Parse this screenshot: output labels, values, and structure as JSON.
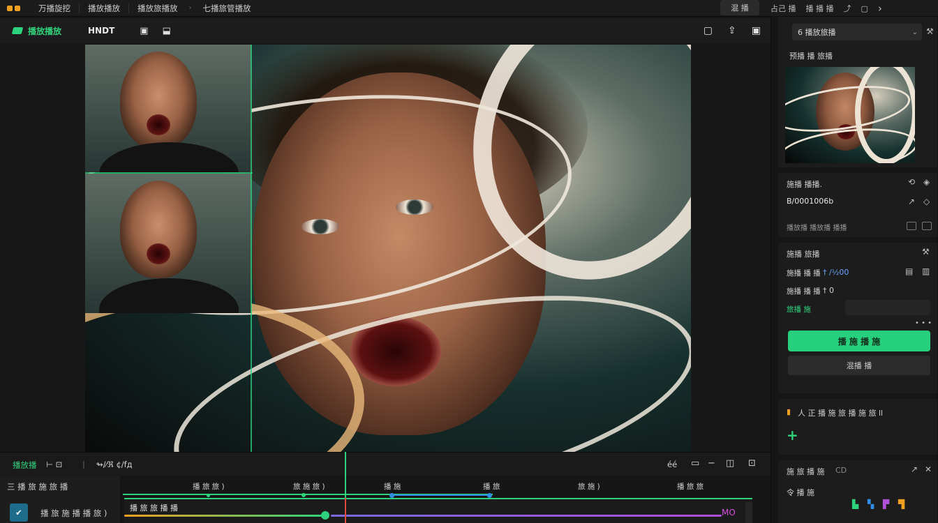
{
  "menubar": {
    "items": [
      "万播旋挖",
      "播放播放",
      "播放旅播放",
      "七播旅管播放"
    ],
    "right_button": "混  播",
    "right_items": [
      "占己 播",
      "播 播 播"
    ]
  },
  "toolbar": {
    "brand": "播放播放",
    "mode": "HNDT"
  },
  "right_panel": {
    "dropdown_value": "6 播放旅播",
    "preview_title": "预播 播 旅播",
    "section1": {
      "title": "施播 播播.",
      "value": "B/0001006b",
      "note": "播放播 播放播 播播"
    },
    "section2": {
      "title": "施播 旅播",
      "row1_label": "施播 播 播",
      "row1_value": "† /½00",
      "row2_label": "施播 播 播",
      "row2_value": "† 0",
      "row3_label": "旅播 施",
      "primary_button": "播 施 播 施",
      "secondary_button": "混播 播"
    },
    "section3": {
      "title": "人 正 播 施 旅 播 施 旅 ll",
      "add": "+"
    },
    "section4": {
      "title": "施 旅 播 施",
      "tab2": "CD",
      "subtitle": "令 播 施"
    }
  },
  "timeline": {
    "toolbar_left": "播放播",
    "toolbar_mid": "⊢ ⊡",
    "toolbar_text": "↬/⁄ℜ ¢/fд",
    "toolbar_right_label": "éé",
    "track_head": "三 播 旅 施 旅 播",
    "track_name": "播 旅 施 播 播 旅 )",
    "ruler_ticks": [
      "播 旅 旅 )",
      "旅 施 旅 )",
      "播 施",
      "播 旅",
      "旅 施 )",
      "播 旅 旅"
    ],
    "clip_name": "播 旅 旅 播 播",
    "clip_end_label": "MO"
  },
  "colors": {
    "accent": "#2ed27c",
    "keyframe_blue": "#2f8de4",
    "keyframe_purple": "#b04fd8",
    "playhead_red": "#e0483a"
  }
}
